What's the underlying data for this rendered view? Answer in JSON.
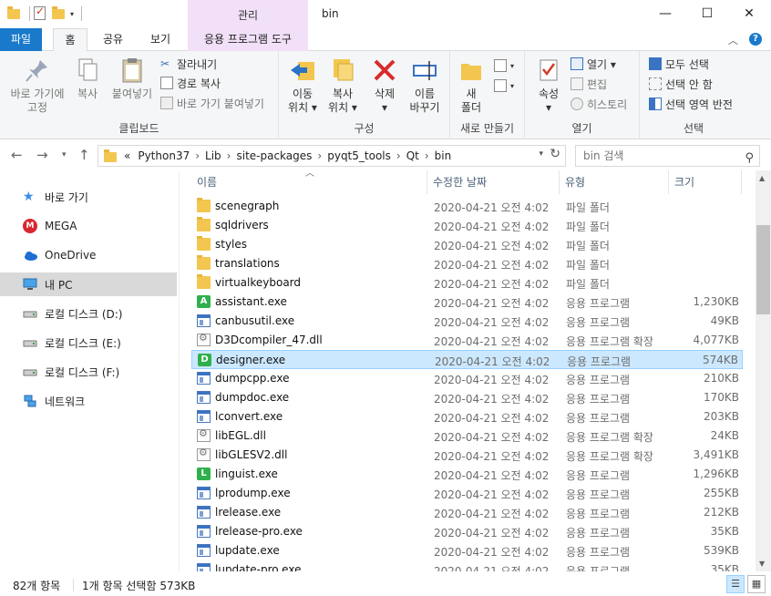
{
  "window": {
    "title": "bin",
    "context_tab": "관리",
    "minimize": "—",
    "maximize": "☐",
    "close": "✕"
  },
  "tabs": {
    "file": "파일",
    "home": "홈",
    "share": "공유",
    "view": "보기",
    "app_tools": "응용 프로그램 도구"
  },
  "ribbon": {
    "clipboard": {
      "label": "클립보드",
      "pin": "바로 가기에\n고정",
      "copy": "복사",
      "paste": "붙여넣기",
      "cut": "잘라내기",
      "copy_path": "경로 복사",
      "paste_shortcut": "바로 가기 붙여넣기"
    },
    "organize": {
      "label": "구성",
      "move_to": "이동\n위치 ▾",
      "copy_to": "복사\n위치 ▾",
      "delete": "삭제\n▾",
      "rename": "이름\n바꾸기"
    },
    "new": {
      "label": "새로 만들기",
      "new_folder": "새\n폴더"
    },
    "open": {
      "label": "열기",
      "properties": "속성\n▾",
      "open": "열기 ▾",
      "edit": "편집",
      "history": "히스토리"
    },
    "select": {
      "label": "선택",
      "select_all": "모두 선택",
      "select_none": "선택 안 함",
      "invert": "선택 영역 반전"
    }
  },
  "address": {
    "crumbs": [
      "«",
      "Python37",
      "Lib",
      "site-packages",
      "pyqt5_tools",
      "Qt",
      "bin"
    ],
    "search_placeholder": "bin 검색"
  },
  "nav": {
    "items": [
      {
        "label": "바로 가기",
        "icon": "star-icon"
      },
      {
        "label": "MEGA",
        "icon": "mega-icon"
      },
      {
        "label": "OneDrive",
        "icon": "cloud-icon"
      },
      {
        "label": "내 PC",
        "icon": "pc-icon"
      },
      {
        "label": "로컬 디스크 (D:)",
        "icon": "drive-icon"
      },
      {
        "label": "로컬 디스크 (E:)",
        "icon": "drive-icon"
      },
      {
        "label": "로컬 디스크 (F:)",
        "icon": "drive-icon"
      },
      {
        "label": "네트워크",
        "icon": "network-icon"
      }
    ]
  },
  "columns": {
    "name": "이름",
    "date": "수정한 날짜",
    "type": "유형",
    "size": "크기"
  },
  "files": [
    {
      "name": "scenegraph",
      "date": "2020-04-21 오전 4:02",
      "type": "파일 폴더",
      "size": "",
      "icon": "folder"
    },
    {
      "name": "sqldrivers",
      "date": "2020-04-21 오전 4:02",
      "type": "파일 폴더",
      "size": "",
      "icon": "folder"
    },
    {
      "name": "styles",
      "date": "2020-04-21 오전 4:02",
      "type": "파일 폴더",
      "size": "",
      "icon": "folder"
    },
    {
      "name": "translations",
      "date": "2020-04-21 오전 4:02",
      "type": "파일 폴더",
      "size": "",
      "icon": "folder"
    },
    {
      "name": "virtualkeyboard",
      "date": "2020-04-21 오전 4:02",
      "type": "파일 폴더",
      "size": "",
      "icon": "folder"
    },
    {
      "name": "assistant.exe",
      "date": "2020-04-21 오전 4:02",
      "type": "응용 프로그램",
      "size": "1,230KB",
      "icon": "qt",
      "letter": "A"
    },
    {
      "name": "canbusutil.exe",
      "date": "2020-04-21 오전 4:02",
      "type": "응용 프로그램",
      "size": "49KB",
      "icon": "app"
    },
    {
      "name": "D3Dcompiler_47.dll",
      "date": "2020-04-21 오전 4:02",
      "type": "응용 프로그램 확장",
      "size": "4,077KB",
      "icon": "dll"
    },
    {
      "name": "designer.exe",
      "date": "2020-04-21 오전 4:02",
      "type": "응용 프로그램",
      "size": "574KB",
      "icon": "qt",
      "letter": "D",
      "selected": true
    },
    {
      "name": "dumpcpp.exe",
      "date": "2020-04-21 오전 4:02",
      "type": "응용 프로그램",
      "size": "210KB",
      "icon": "app"
    },
    {
      "name": "dumpdoc.exe",
      "date": "2020-04-21 오전 4:02",
      "type": "응용 프로그램",
      "size": "170KB",
      "icon": "app"
    },
    {
      "name": "lconvert.exe",
      "date": "2020-04-21 오전 4:02",
      "type": "응용 프로그램",
      "size": "203KB",
      "icon": "app"
    },
    {
      "name": "libEGL.dll",
      "date": "2020-04-21 오전 4:02",
      "type": "응용 프로그램 확장",
      "size": "24KB",
      "icon": "dll"
    },
    {
      "name": "libGLESV2.dll",
      "date": "2020-04-21 오전 4:02",
      "type": "응용 프로그램 확장",
      "size": "3,491KB",
      "icon": "dll"
    },
    {
      "name": "linguist.exe",
      "date": "2020-04-21 오전 4:02",
      "type": "응용 프로그램",
      "size": "1,296KB",
      "icon": "qt",
      "letter": "L"
    },
    {
      "name": "lprodump.exe",
      "date": "2020-04-21 오전 4:02",
      "type": "응용 프로그램",
      "size": "255KB",
      "icon": "app"
    },
    {
      "name": "lrelease.exe",
      "date": "2020-04-21 오전 4:02",
      "type": "응용 프로그램",
      "size": "212KB",
      "icon": "app"
    },
    {
      "name": "lrelease-pro.exe",
      "date": "2020-04-21 오전 4:02",
      "type": "응용 프로그램",
      "size": "35KB",
      "icon": "app"
    },
    {
      "name": "lupdate.exe",
      "date": "2020-04-21 오전 4:02",
      "type": "응용 프로그램",
      "size": "539KB",
      "icon": "app"
    },
    {
      "name": "lupdate-pro.exe",
      "date": "2020-04-21 오전 4:02",
      "type": "응용 프로그램",
      "size": "35KB",
      "icon": "app"
    }
  ],
  "status": {
    "count": "82개 항목",
    "selection": "1개 항목 선택함 573KB"
  },
  "colors": {
    "accent": "#1979ca",
    "selection": "#cce8ff",
    "context_tab": "#f1e0f7"
  }
}
